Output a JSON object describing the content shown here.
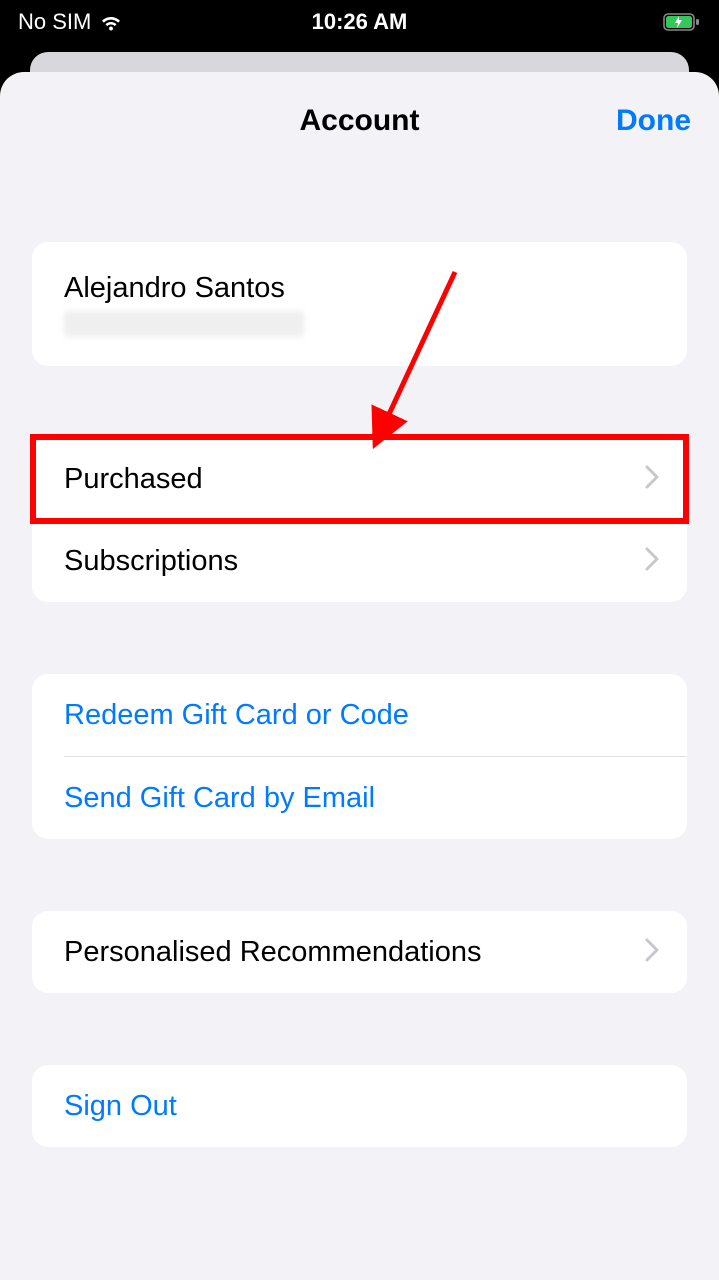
{
  "status_bar": {
    "carrier": "No SIM",
    "time": "10:26 AM"
  },
  "modal": {
    "title": "Account",
    "done_label": "Done"
  },
  "profile": {
    "name": "Alejandro Santos"
  },
  "menu": {
    "purchased": "Purchased",
    "subscriptions": "Subscriptions",
    "redeem": "Redeem Gift Card or Code",
    "send_gift": "Send Gift Card by Email",
    "recommendations": "Personalised Recommendations",
    "sign_out": "Sign Out"
  }
}
